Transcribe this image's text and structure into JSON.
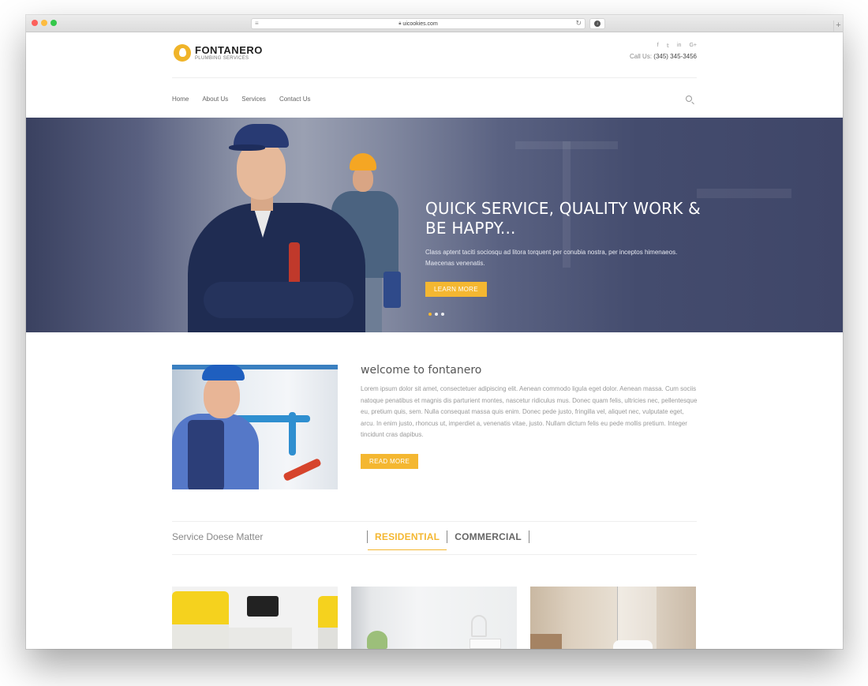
{
  "browser": {
    "url": "uicookies.com"
  },
  "site": {
    "logo": {
      "name": "FONTANERO",
      "tagline": "PLUMBING SERVICES"
    },
    "socials": [
      "facebook-icon",
      "twitter-icon",
      "linkedin-icon",
      "google-plus-icon"
    ],
    "social_glyphs": [
      "f",
      "𝕥",
      "in",
      "G+"
    ],
    "call": {
      "label": "Call Us:",
      "phone": "(345) 345-3456"
    },
    "nav": {
      "items": [
        {
          "label": "Home"
        },
        {
          "label": "About Us"
        },
        {
          "label": "Services"
        },
        {
          "label": "Contact Us"
        }
      ]
    }
  },
  "hero": {
    "title": "QUICK SERVICE, QUALITY WORK & BE HAPPY...",
    "subtitle": "Class aptent taciti sociosqu ad litora torquent per conubia nostra, per inceptos himenaeos. Maecenas venenatis.",
    "button_label": "LEARN MORE",
    "slide_count": 3,
    "active_slide": 1
  },
  "welcome": {
    "title": "welcome to fontanero",
    "body": "Lorem ipsum dolor sit amet, consectetuer adipiscing elit. Aenean commodo ligula eget dolor. Aenean massa. Cum sociis natoque penatibus et magnis dis parturient montes, nascetur ridiculus mus. Donec quam felis, ultricies nec, pellentesque eu, pretium quis, sem. Nulla consequat massa quis enim. Donec pede justo, fringilla vel, aliquet nec, vulputate eget, arcu. In enim justo, rhoncus ut, imperdiet a, venenatis vitae, justo. Nullam dictum felis eu pede mollis pretium. Integer tincidunt cras dapibus.",
    "button_label": "READ MORE"
  },
  "services": {
    "title": "Service Doese Matter",
    "tabs": [
      {
        "label": "RESIDENTIAL",
        "active": true
      },
      {
        "label": "COMMERCIAL",
        "active": false
      }
    ]
  },
  "colors": {
    "accent": "#f4b731",
    "hero_bg": "#3f4668",
    "text_dark": "#222222"
  }
}
